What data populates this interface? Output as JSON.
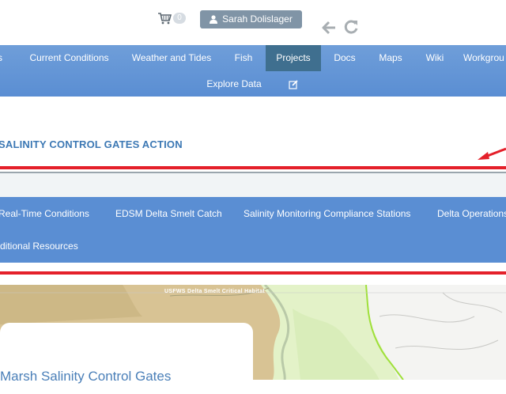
{
  "header": {
    "cart_count": "0",
    "user_name": "Sarah Dolislager"
  },
  "nav": {
    "items": [
      {
        "label": "s"
      },
      {
        "label": "Current Conditions"
      },
      {
        "label": "Weather and Tides"
      },
      {
        "label": "Fish"
      },
      {
        "label": "Projects"
      },
      {
        "label": "Docs"
      },
      {
        "label": "Maps"
      },
      {
        "label": "Wiki"
      },
      {
        "label": "Workgrou"
      }
    ],
    "row2": {
      "label": "Explore Data"
    },
    "active": "Projects"
  },
  "page": {
    "title": "SALINITY CONTROL GATES ACTION"
  },
  "subnav": {
    "items": [
      {
        "label": "Real-Time Conditions"
      },
      {
        "label": "EDSM Delta Smelt Catch"
      },
      {
        "label": "Salinity Monitoring Compliance Stations"
      },
      {
        "label": "Delta Operations"
      },
      {
        "label": "ditional Resources"
      }
    ]
  },
  "map": {
    "habitat_label": "USFWS Delta Smelt Critical Habitat",
    "panel_title": "Marsh Salinity Control Gates"
  },
  "colors": {
    "nav_blue": "#5a8ed3",
    "active_tab": "#3f6f8f",
    "annotation_red": "#e4202a",
    "title_blue": "#3c78b4"
  },
  "icons": [
    "cart-icon",
    "user-icon",
    "back-arrow-icon",
    "refresh-icon",
    "edit-icon",
    "red-arrow-annotation"
  ]
}
